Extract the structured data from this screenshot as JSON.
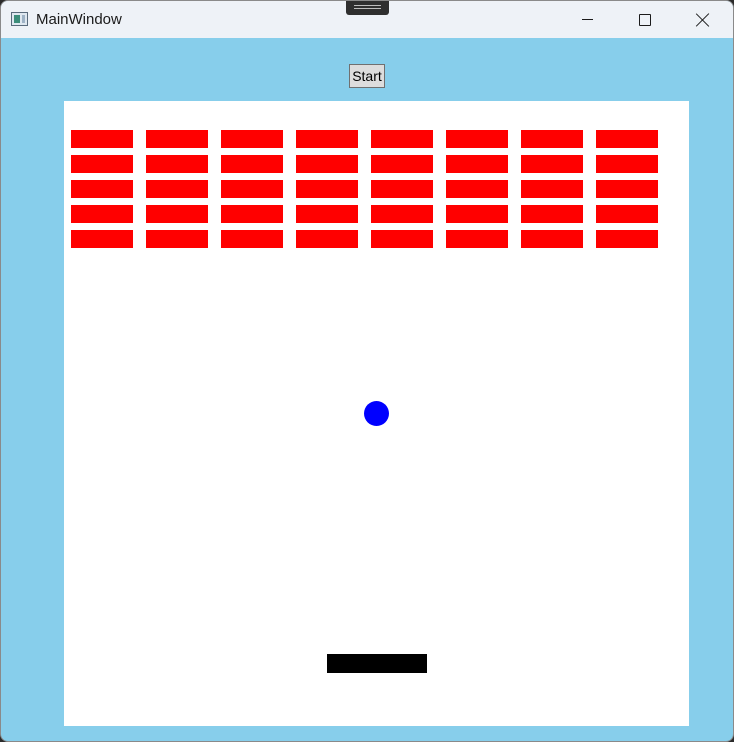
{
  "window": {
    "title": "MainWindow",
    "icon": "app-window-icon",
    "controls": {
      "minimize_icon": "minimize-icon",
      "maximize_icon": "maximize-icon",
      "close_icon": "close-icon"
    }
  },
  "toolbar": {
    "start_label": "Start"
  },
  "game": {
    "background_color": "#87ceeb",
    "canvas_color": "#ffffff",
    "brick_color": "#ff0000",
    "brick_rows": 5,
    "brick_columns": 8,
    "ball_color": "#0000ff",
    "paddle_color": "#000000"
  }
}
